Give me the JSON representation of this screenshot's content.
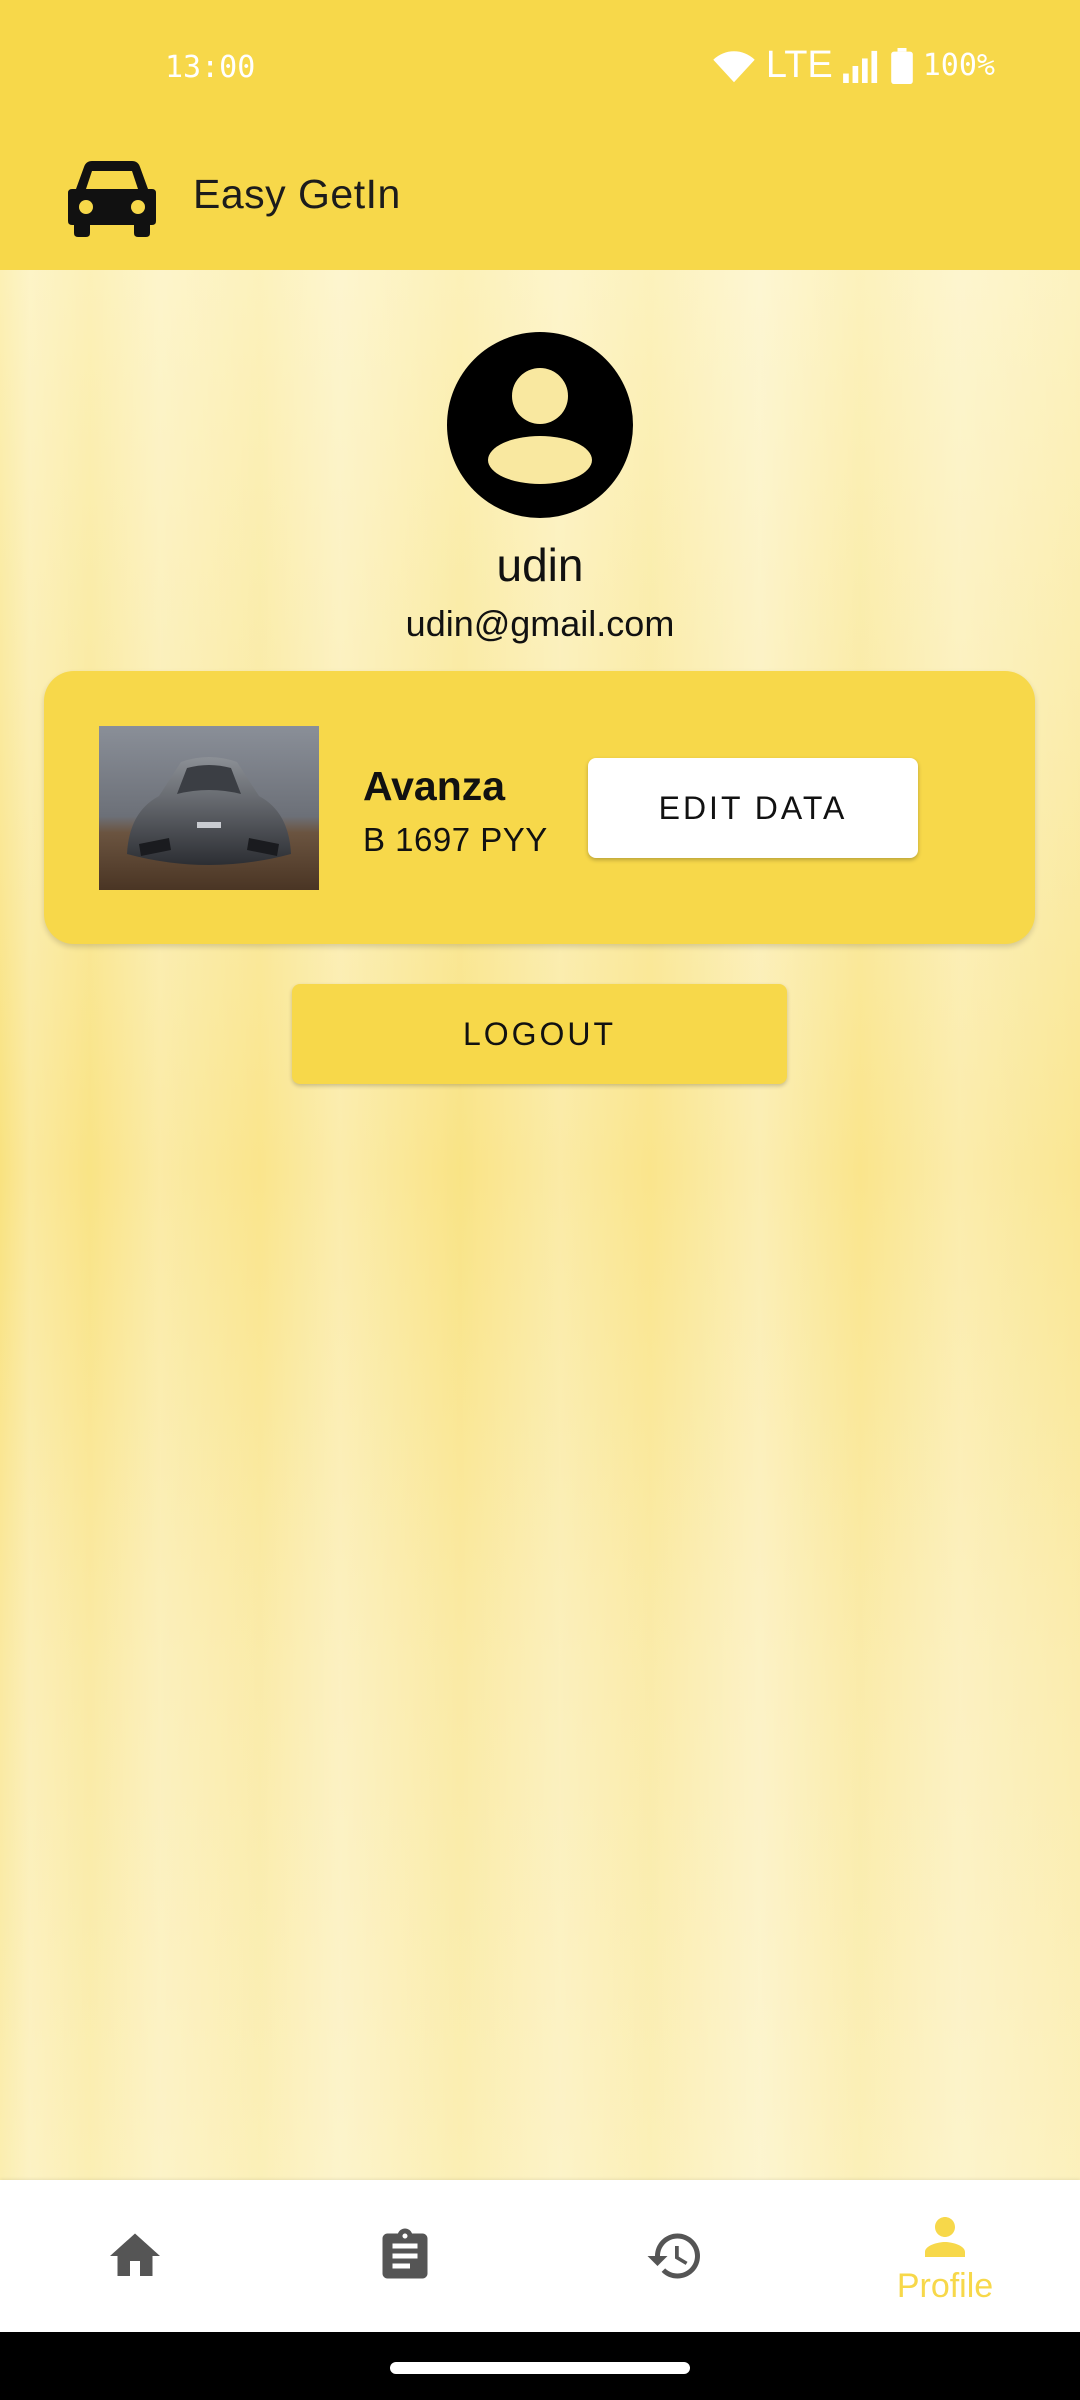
{
  "status_bar": {
    "time": "13:00",
    "network": "LTE",
    "battery": "100%"
  },
  "app_bar": {
    "title": "Easy GetIn"
  },
  "profile": {
    "name": "udin",
    "email": "udin@gmail.com"
  },
  "vehicle": {
    "name": "Avanza",
    "plate": "B 1697 PYY",
    "edit_label": "EDIT DATA"
  },
  "actions": {
    "logout_label": "LOGOUT"
  },
  "bottom_nav": {
    "items": [
      {
        "icon": "home-icon",
        "label": ""
      },
      {
        "icon": "clipboard-icon",
        "label": ""
      },
      {
        "icon": "history-icon",
        "label": ""
      },
      {
        "icon": "person-icon",
        "label": "Profile",
        "active": true
      }
    ]
  },
  "colors": {
    "primary": "#f7d84a",
    "nav_inactive": "#555555",
    "text": "#111111"
  }
}
